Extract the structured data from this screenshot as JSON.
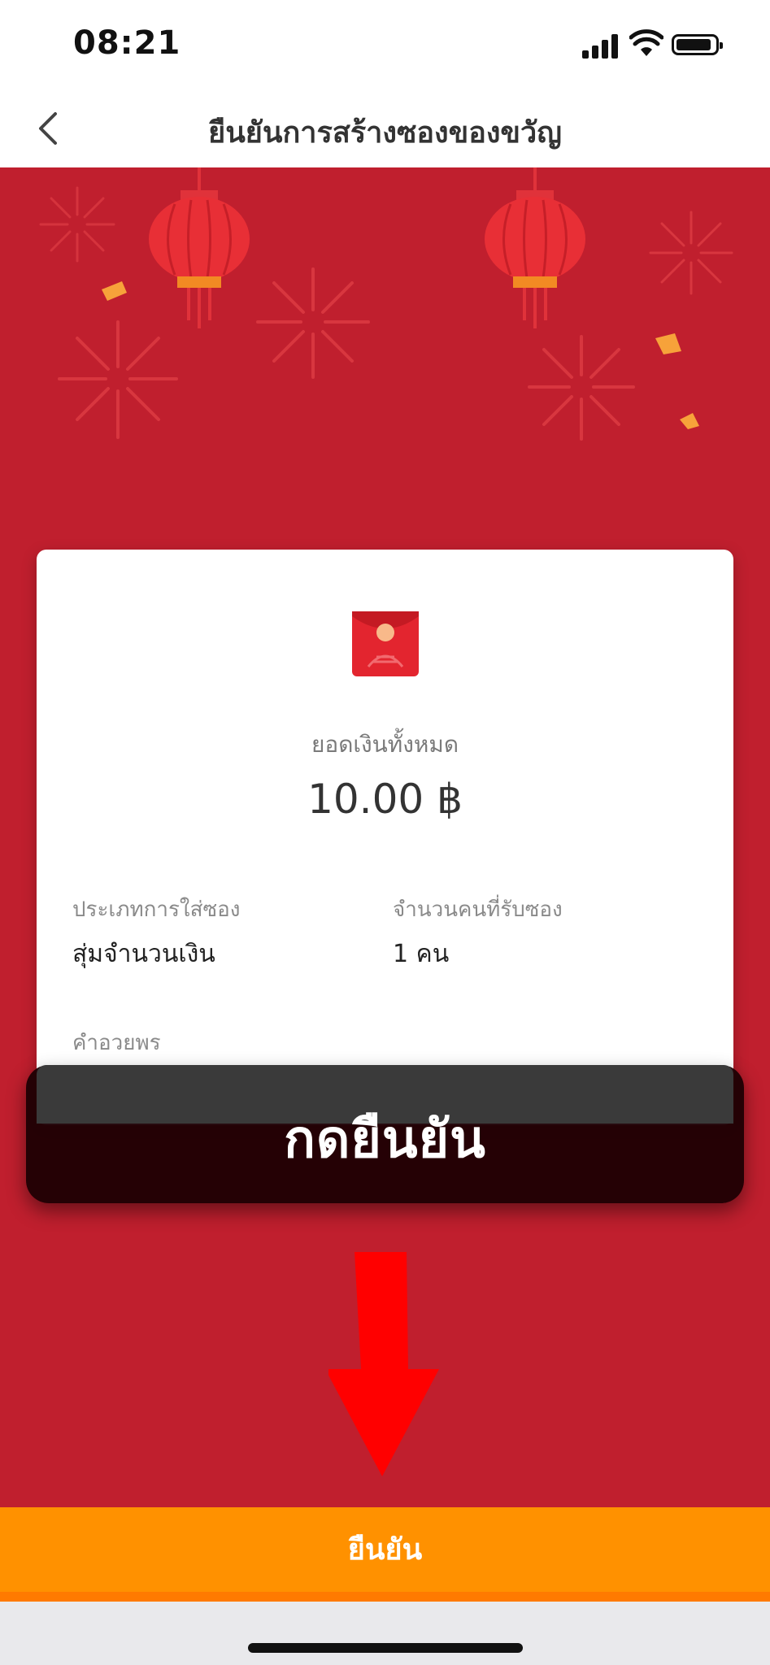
{
  "status_bar": {
    "time": "08:21"
  },
  "nav": {
    "title": "ยืนยันการสร้างซองของขวัญ"
  },
  "card": {
    "total_label": "ยอดเงินทั้งหมด",
    "total_value": "10.00 ฿",
    "fields": [
      {
        "label": "ประเภทการใส่ซอง",
        "value": "สุ่มจำนวนเงิน"
      },
      {
        "label": "จำนวนคนที่รับซอง",
        "value": "1 คน"
      },
      {
        "label": "คำอวยพร",
        "value": ""
      }
    ]
  },
  "overlay": {
    "text": "กดยืนยัน"
  },
  "confirm_button": {
    "label": "ยืนยัน"
  },
  "colors": {
    "background": "#c01f2e",
    "accent": "#ff9100",
    "arrow": "#ff0000"
  }
}
